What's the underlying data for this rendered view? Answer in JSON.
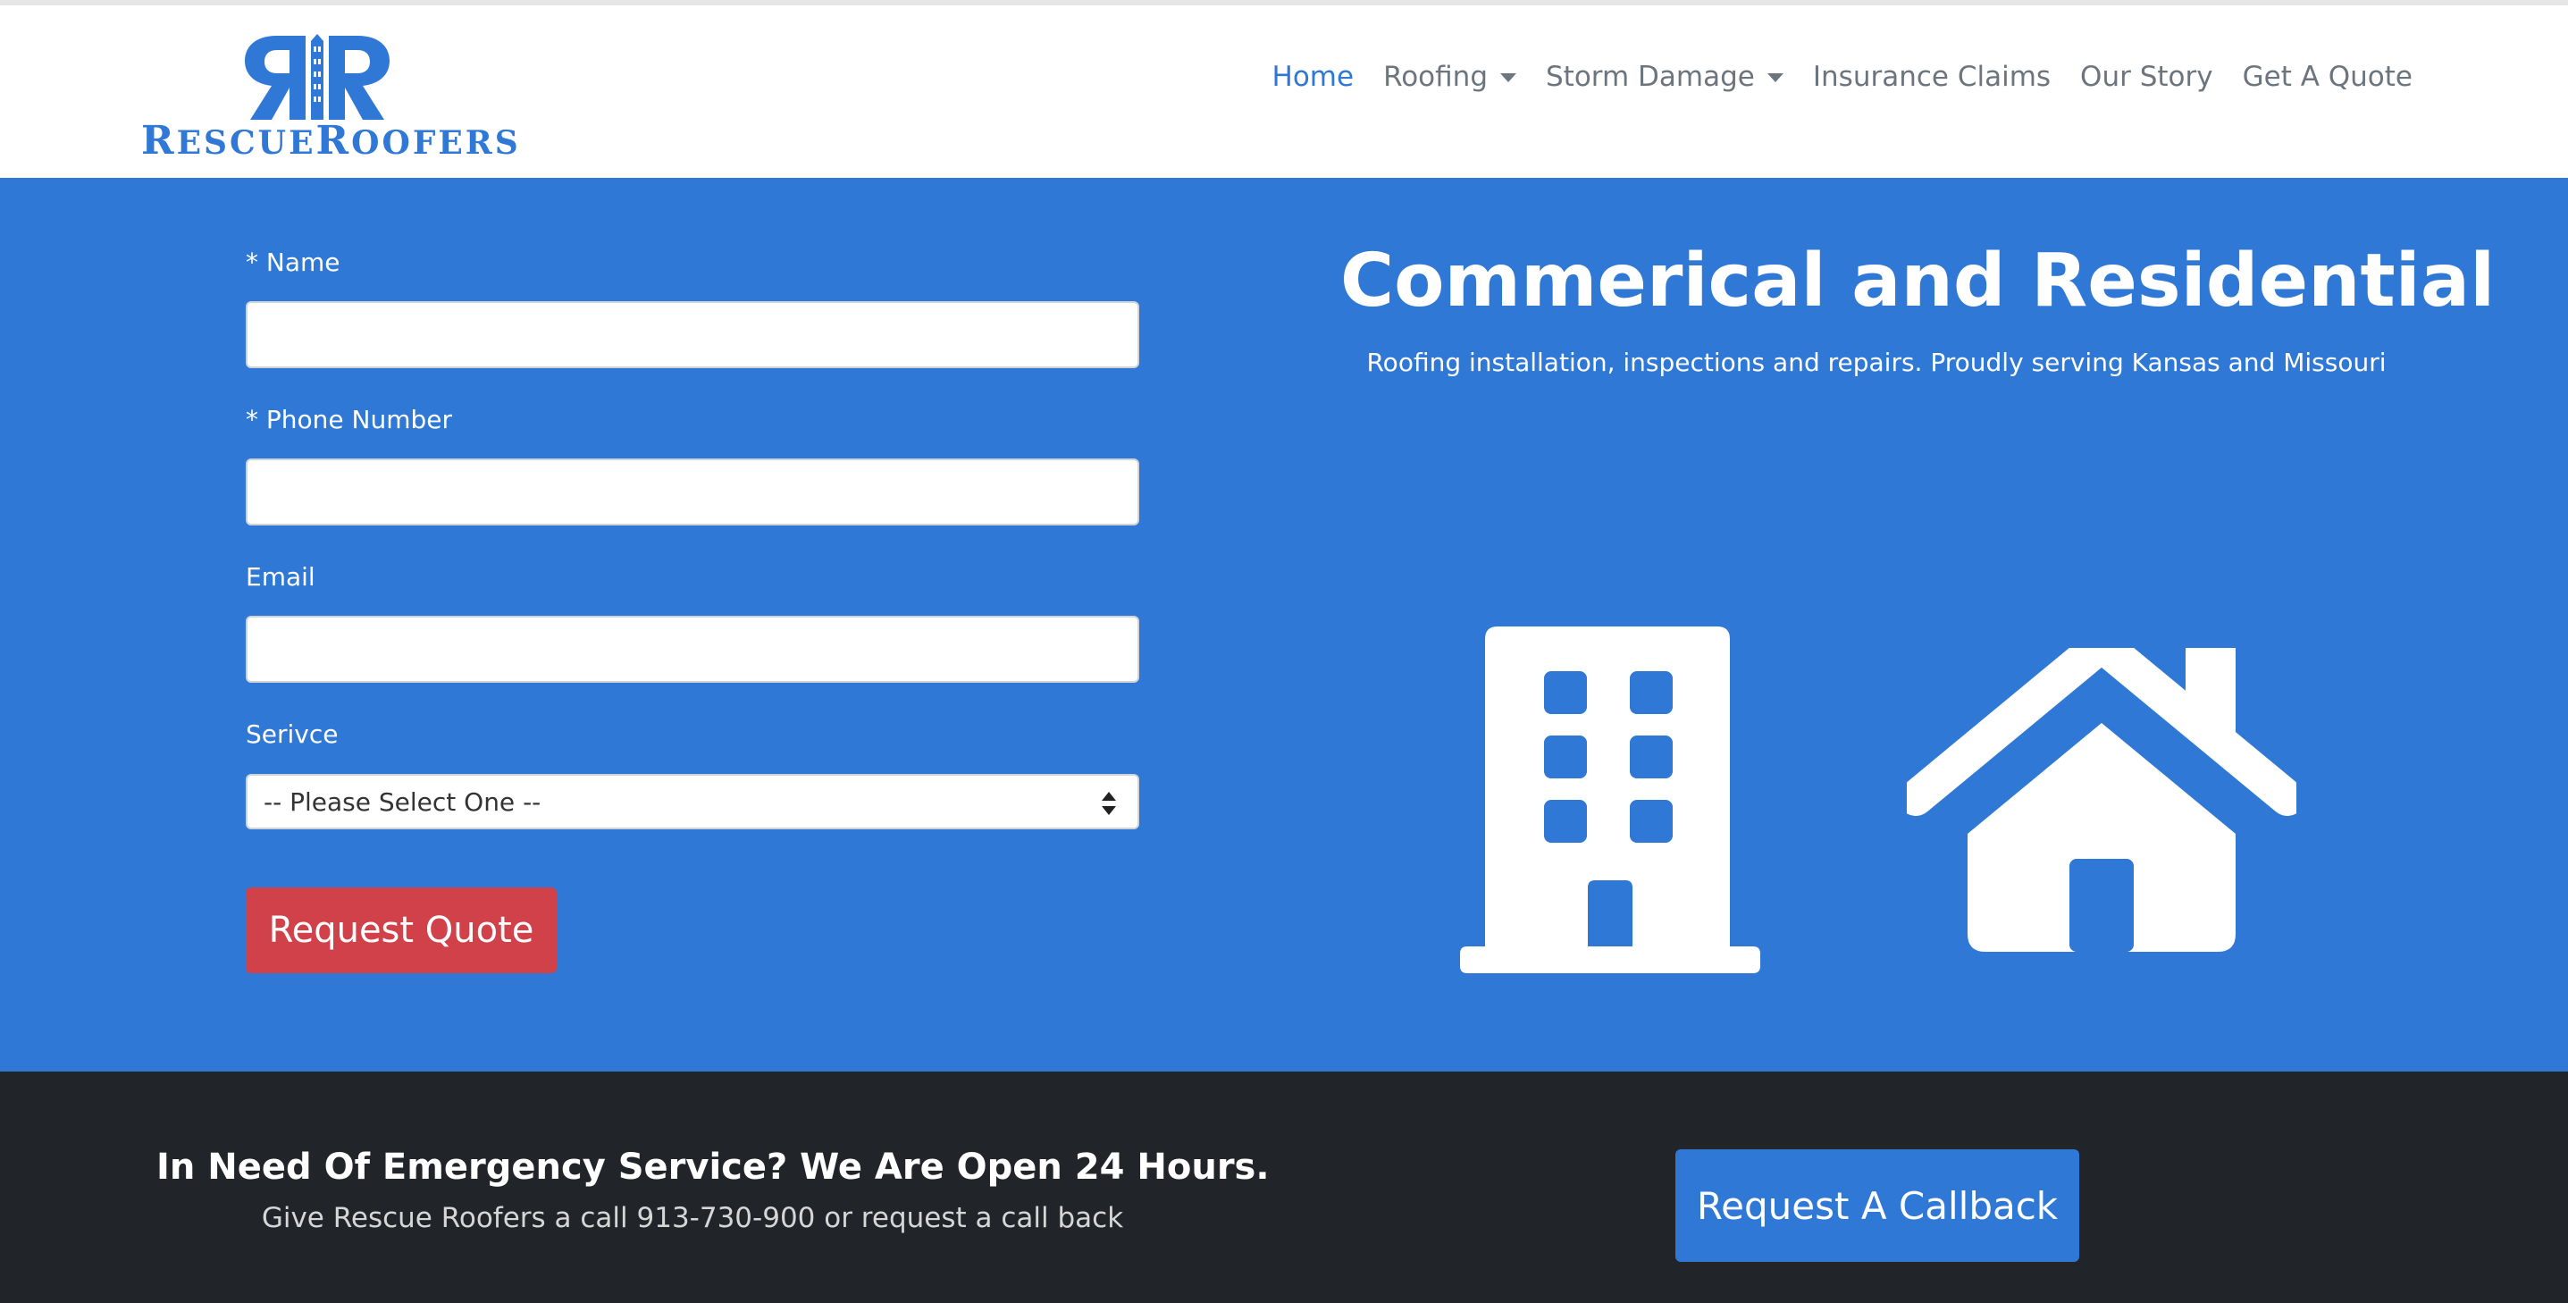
{
  "brand": {
    "logo_text_first": "R",
    "logo_text_rest": "ESCUE",
    "logo_text_second": "R",
    "logo_text_second_rest": "OOFERS"
  },
  "nav": {
    "items": [
      {
        "label": "Home",
        "active": true
      },
      {
        "label": "Roofing",
        "dropdown": true
      },
      {
        "label": "Storm Damage",
        "dropdown": true
      },
      {
        "label": "Insurance Claims"
      },
      {
        "label": "Our Story"
      },
      {
        "label": "Get A Quote"
      }
    ]
  },
  "form": {
    "name_label": "* Name",
    "name_value": "",
    "phone_label": "* Phone Number",
    "phone_value": "",
    "email_label": "Email",
    "email_value": "",
    "service_label": "Serivce",
    "service_selected": "-- Please Select One --",
    "submit_label": "Request Quote"
  },
  "hero": {
    "title": "Commerical and Residential",
    "subtitle": "Roofing installation, inspections and repairs. Proudly serving Kansas and Missouri",
    "icons": [
      "building-icon",
      "house-icon"
    ]
  },
  "cta": {
    "title": "In Need Of Emergency Service? We Are Open 24 Hours.",
    "subtitle": "Give Rescue Roofers a call 913-730-900 or request a call back",
    "button_label": "Request A Callback"
  },
  "colors": {
    "primary": "#2f78d6",
    "danger": "#d0414a",
    "dark": "#212529",
    "nav_text": "#6c757d"
  }
}
